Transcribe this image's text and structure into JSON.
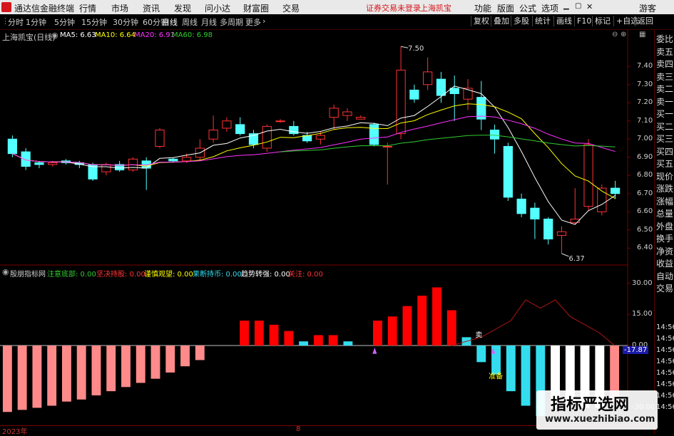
{
  "menubar": {
    "app_title": "通达信金融终端",
    "items": [
      "行情",
      "市场",
      "资讯",
      "发现",
      "问小达",
      "财富圈",
      "交易"
    ],
    "warning": "证券交易未登录",
    "stock_name": "上海凯宝",
    "right_items": [
      "功能",
      "版面",
      "公式",
      "选项"
    ],
    "guest": "游客"
  },
  "toolbar": {
    "periods": [
      "分时",
      "1分钟",
      "5分钟",
      "15分钟",
      "30分钟",
      "60分钟",
      "日线",
      "周线",
      "月线",
      "多周期",
      "更多"
    ],
    "active_period": "日线",
    "right_buttons": [
      "复权",
      "叠加",
      "多股",
      "统计",
      "画线",
      "F10",
      "标记",
      "+自选",
      "返回"
    ]
  },
  "main_chart": {
    "title": "上海凯宝(日线)",
    "ma": [
      {
        "label": "MA5: 6.63",
        "color": "#ffffff"
      },
      {
        "label": "MA10: 6.64",
        "color": "#ffff00"
      },
      {
        "label": "MA20: 6.91",
        "color": "#ff33ff"
      },
      {
        "label": "MA60: 6.98",
        "color": "#33cc33"
      }
    ],
    "high_label": "7.50",
    "low_label": "6.37",
    "y_ticks": [
      "7.40",
      "7.30",
      "7.20",
      "7.10",
      "7.00",
      "6.90",
      "6.80",
      "6.70",
      "6.60",
      "6.50",
      "6.40"
    ]
  },
  "indicator": {
    "name": "殷朋指标网",
    "items": [
      {
        "label": "注意底部: 0.00",
        "color": "#33cc33"
      },
      {
        "label": "坚决持股: 0.00",
        "color": "#ff3333"
      },
      {
        "label": "谨慎观望: 0.00",
        "color": "#ffff00"
      },
      {
        "label": "果断持币: 0.00",
        "color": "#33ddee"
      },
      {
        "label": "趋势转强: 0.00",
        "color": "#ffffff"
      },
      {
        "label": "关注: 0.00",
        "color": "#ff3333"
      }
    ],
    "y_ticks": [
      "30.00",
      "15.00",
      "0.00",
      "-30.00"
    ],
    "current_value": "-17.87",
    "annot_sell": "卖",
    "annot_ready": "准备"
  },
  "side_panel": {
    "labels": [
      "委比",
      "卖五",
      "卖四",
      "卖三",
      "卖二",
      "卖一",
      "买一",
      "买二",
      "买三",
      "买四",
      "买五",
      "现价",
      "涨跌",
      "涨幅",
      "总量",
      "外盘",
      "换手",
      "净资",
      "收益",
      "自动",
      "交易"
    ],
    "times": [
      "14:56",
      "14:56",
      "14:56",
      "14:56",
      "14:56",
      "14:56",
      "14:56",
      "14:56"
    ]
  },
  "bottom": {
    "year": "2023年",
    "month": "8"
  },
  "watermark": {
    "line1": "指标严选网",
    "line2": "www.xuezhibiao.com"
  },
  "chart_data": {
    "type": "candlestick",
    "price_range": [
      6.35,
      7.55
    ],
    "candles": [
      [
        7.0,
        6.92,
        7.02,
        6.9
      ],
      [
        6.93,
        6.85,
        6.95,
        6.83
      ],
      [
        6.87,
        6.86,
        6.88,
        6.84
      ],
      [
        6.86,
        6.87,
        6.88,
        6.85
      ],
      [
        6.88,
        6.87,
        6.89,
        6.86
      ],
      [
        6.87,
        6.86,
        6.88,
        6.84
      ],
      [
        6.86,
        6.78,
        6.87,
        6.77
      ],
      [
        6.82,
        6.86,
        6.87,
        6.8
      ],
      [
        6.86,
        6.83,
        6.88,
        6.82
      ],
      [
        6.83,
        6.89,
        6.9,
        6.82
      ],
      [
        6.88,
        6.84,
        6.9,
        6.72
      ],
      [
        6.96,
        7.05,
        7.06,
        6.95
      ],
      [
        6.89,
        6.88,
        6.9,
        6.87
      ],
      [
        6.88,
        6.9,
        6.92,
        6.87
      ],
      [
        6.9,
        6.95,
        7.0,
        6.88
      ],
      [
        7.0,
        7.05,
        7.13,
        6.98
      ],
      [
        7.06,
        7.1,
        7.12,
        7.04
      ],
      [
        7.08,
        7.03,
        7.12,
        7.02
      ],
      [
        7.03,
        6.97,
        7.05,
        6.95
      ],
      [
        6.95,
        7.07,
        7.08,
        6.93
      ],
      [
        7.1,
        7.1,
        7.11,
        7.09
      ],
      [
        7.07,
        7.03,
        7.1,
        7.02
      ],
      [
        7.02,
        6.99,
        7.04,
        6.98
      ],
      [
        7.0,
        7.02,
        7.04,
        6.97
      ],
      [
        7.12,
        7.17,
        7.19,
        7.05
      ],
      [
        7.13,
        7.15,
        7.17,
        7.1
      ],
      [
        7.11,
        7.12,
        7.13,
        7.11
      ],
      [
        7.08,
        6.97,
        7.09,
        6.96
      ],
      [
        6.96,
        6.96,
        6.98,
        6.75
      ],
      [
        7.03,
        7.38,
        7.51,
        7.0
      ],
      [
        7.27,
        7.22,
        7.3,
        7.2
      ],
      [
        7.3,
        7.37,
        7.45,
        7.27
      ],
      [
        7.33,
        7.24,
        7.37,
        7.2
      ],
      [
        7.28,
        7.25,
        7.35,
        7.1
      ],
      [
        7.22,
        7.28,
        7.33,
        7.16
      ],
      [
        7.23,
        7.11,
        7.32,
        7.05
      ],
      [
        7.05,
        7.0,
        7.08,
        6.92
      ],
      [
        6.96,
        6.68,
        6.98,
        6.66
      ],
      [
        6.67,
        6.59,
        6.7,
        6.57
      ],
      [
        6.62,
        6.56,
        6.65,
        6.45
      ],
      [
        6.56,
        6.45,
        6.57,
        6.42
      ],
      [
        6.47,
        6.49,
        6.52,
        6.37
      ],
      [
        6.54,
        6.56,
        6.73,
        6.53
      ],
      [
        6.63,
        6.97,
        7.0,
        6.61
      ],
      [
        6.6,
        6.73,
        6.75,
        6.58
      ],
      [
        6.73,
        6.7,
        6.77,
        6.67
      ]
    ],
    "ma_labels": [
      "MA5",
      "MA10",
      "MA20",
      "MA60"
    ],
    "indicator_range": [
      -35,
      35
    ],
    "indicator_bars": [
      {
        "v": -32,
        "c": "#ff8a8a"
      },
      {
        "v": -31,
        "c": "#ff8a8a"
      },
      {
        "v": -30,
        "c": "#ff8a8a"
      },
      {
        "v": -29,
        "c": "#ff8a8a"
      },
      {
        "v": -27,
        "c": "#ff8a8a"
      },
      {
        "v": -26,
        "c": "#ff8a8a"
      },
      {
        "v": -24,
        "c": "#ff8a8a"
      },
      {
        "v": -22,
        "c": "#ff8a8a"
      },
      {
        "v": -20,
        "c": "#ff8a8a"
      },
      {
        "v": -18,
        "c": "#ff8a8a"
      },
      {
        "v": -16,
        "c": "#ff8a8a"
      },
      {
        "v": -13,
        "c": "#ff8a8a"
      },
      {
        "v": -10,
        "c": "#ff8a8a"
      },
      {
        "v": -7,
        "c": "#ff8a8a"
      },
      {
        "v": 0,
        "c": "#000000"
      },
      {
        "v": 0,
        "c": "#000000"
      },
      {
        "v": 12,
        "c": "#ff0000"
      },
      {
        "v": 12,
        "c": "#ff0000"
      },
      {
        "v": 10,
        "c": "#ff0000"
      },
      {
        "v": 7,
        "c": "#ff0000"
      },
      {
        "v": 2,
        "c": "#33ddee"
      },
      {
        "v": 5,
        "c": "#ff0000"
      },
      {
        "v": 5,
        "c": "#ff0000"
      },
      {
        "v": 2,
        "c": "#33ddee"
      },
      {
        "v": 0,
        "c": "#000000"
      },
      {
        "v": 12,
        "c": "#ff0000"
      },
      {
        "v": 14,
        "c": "#ff0000"
      },
      {
        "v": 19,
        "c": "#ff0000"
      },
      {
        "v": 24,
        "c": "#ff0000"
      },
      {
        "v": 28,
        "c": "#ff0000"
      },
      {
        "v": 17,
        "c": "#ff0000"
      },
      {
        "v": 4,
        "c": "#33ddee"
      },
      {
        "v": -8,
        "c": "#33ddee"
      },
      {
        "v": -14,
        "c": "#33ddee"
      },
      {
        "v": -22,
        "c": "#33ddee"
      },
      {
        "v": -29,
        "c": "#33ddee"
      },
      {
        "v": -34,
        "c": "#33ddee"
      },
      {
        "v": -30,
        "c": "#ffffff"
      },
      {
        "v": -30,
        "c": "#ffffff"
      },
      {
        "v": -30,
        "c": "#ffffff"
      },
      {
        "v": -30,
        "c": "#ffffff"
      },
      {
        "v": -27,
        "c": "#ff8a8a"
      }
    ]
  }
}
